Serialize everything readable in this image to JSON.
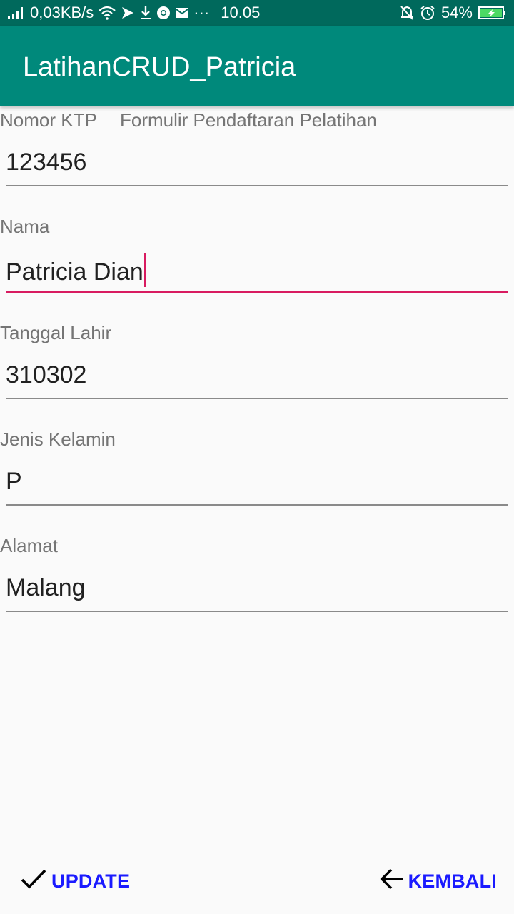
{
  "status_bar": {
    "net_speed": "0,03KB/s",
    "dots": "···",
    "time": "10.05",
    "battery": "54%",
    "icons": [
      "signal-icon",
      "wifi-icon",
      "flipboard-icon",
      "download-icon",
      "chrome-icon",
      "mail-icon",
      "bell-off-icon",
      "alarm-icon",
      "battery-charging-icon"
    ]
  },
  "app_bar": {
    "title": "LatihanCRUD_Patricia"
  },
  "form": {
    "heading": "Formulir Pendaftaran Pelatihan",
    "fields": [
      {
        "label": "Nomor KTP",
        "value": "123456"
      },
      {
        "label": "Nama",
        "value": "Patricia Dian"
      },
      {
        "label": "Tanggal Lahir",
        "value": "310302"
      },
      {
        "label": "Jenis Kelamin",
        "value": "P"
      },
      {
        "label": "Alamat",
        "value": "Malang"
      }
    ]
  },
  "actions": {
    "update_label": "UPDATE",
    "back_label": "KEMBALI",
    "update_icon": "check-icon",
    "back_icon": "arrow-back-icon"
  },
  "colors": {
    "primary": "#00897b",
    "primary_dark": "#00695c",
    "accent": "#d81b60",
    "button_text": "#1a1aff"
  }
}
